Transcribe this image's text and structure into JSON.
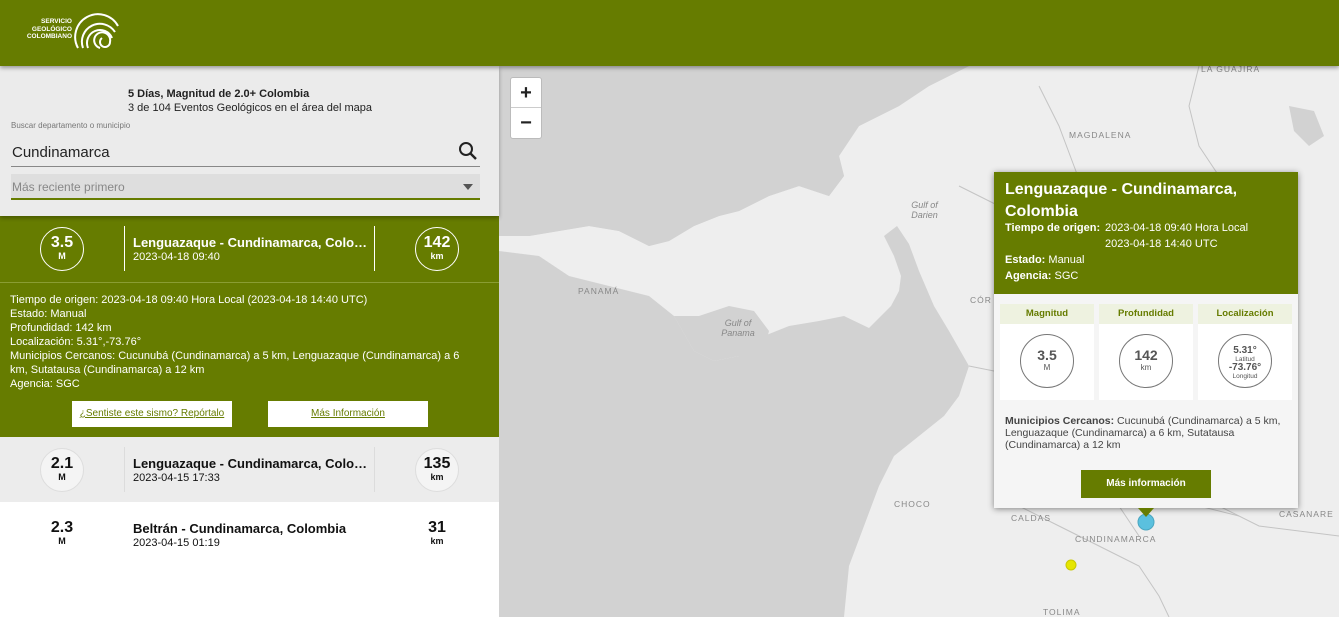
{
  "header": {
    "logo_text": "SERVICIO GEOLÓGICO COLOMBIANO",
    "brand_color": "#667c00"
  },
  "panel": {
    "title": "5 Días, Magnitud de 2.0+ Colombia",
    "count": "3 de 104 Eventos Geológicos en el área del mapa",
    "search_label": "Buscar departamento o municipio",
    "search_value": "Cundinamarca",
    "sort_value": "Más reciente primero"
  },
  "events": [
    {
      "magnitude": "3.5",
      "mag_unit": "M",
      "name": "Lenguazaque - Cundinamarca, Colombia",
      "time": "2023-04-18 09:40",
      "depth": "142",
      "depth_unit": "km",
      "selected": true
    },
    {
      "magnitude": "2.1",
      "mag_unit": "M",
      "name": "Lenguazaque - Cundinamarca, Colombia",
      "time": "2023-04-15 17:33",
      "depth": "135",
      "depth_unit": "km"
    },
    {
      "magnitude": "2.3",
      "mag_unit": "M",
      "name": "Beltrán - Cundinamarca, Colombia",
      "time": "2023-04-15 01:19",
      "depth": "31",
      "depth_unit": "km"
    }
  ],
  "detail": {
    "origin_time": "Tiempo de origen: 2023-04-18 09:40 Hora Local (2023-04-18 14:40 UTC)",
    "status": "Estado: Manual",
    "depth": "Profundidad: 142 km",
    "location": "Localización: 5.31°,-73.76°",
    "municipalities": "Municipios Cercanos: Cucunubá (Cundinamarca) a 5 km, Lenguazaque (Cundinamarca) a 6 km, Sutatausa (Cundinamarca) a 12 km",
    "agency": "Agencia: SGC",
    "report_button": "¿Sentiste este sismo? Repórtalo",
    "more_button": "Más Información"
  },
  "map": {
    "zoom_in": "+",
    "zoom_out": "−",
    "labels": {
      "la_guajira": "LA GUAJIRA",
      "magdalena": "MAGDALENA",
      "gulf_darien": "Gulf of Darien",
      "panama": "PANAMÁ",
      "gulf_panama": "Gulf of Panama",
      "cordoba": "CÓR",
      "choco": "CHOCO",
      "caldas": "CALDAS",
      "cundinamarca": "CUNDINAMARCA",
      "casanare": "CASANARE",
      "tolima": "TOLIMA"
    },
    "marker_colors": {
      "selected": "#5bc0de",
      "other": "#e6e600"
    }
  },
  "popup": {
    "title": "Lenguazaque - Cundinamarca, Colombia",
    "origin_label": "Tiempo de origen:",
    "origin_local": "2023-04-18 09:40 Hora Local",
    "origin_utc": "2023-04-18 14:40 UTC",
    "status_label": "Estado:",
    "status_value": "Manual",
    "agency_label": "Agencia:",
    "agency_value": "SGC",
    "col_magnitude": "Magnitud",
    "col_depth": "Profundidad",
    "col_location": "Localización",
    "magnitude": "3.5",
    "mag_unit": "M",
    "depth": "142",
    "depth_unit": "km",
    "latitude": "5.31°",
    "latitude_label": "Latitud",
    "longitude": "-73.76°",
    "longitude_label": "Longitud",
    "mun_label": "Municipios Cercanos:",
    "mun_value": "Cucunubá (Cundinamarca) a 5 km, Lenguazaque (Cundinamarca) a 6 km, Sutatausa (Cundinamarca) a 12 km",
    "more_button": "Más información"
  }
}
